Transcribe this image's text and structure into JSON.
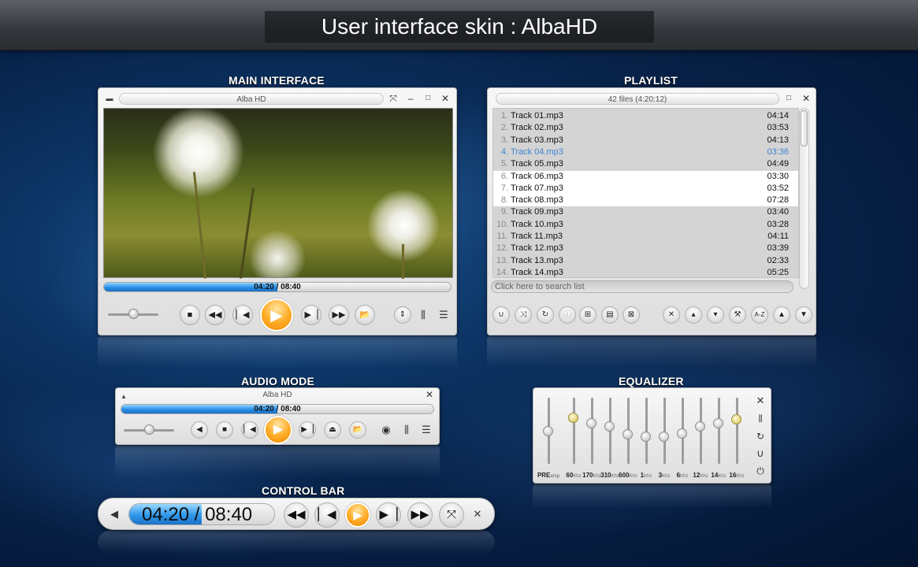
{
  "banner": {
    "title": "User interface skin : AlbaHD"
  },
  "colors": {
    "accent_blue": "#2a8fe6",
    "accent_orange": "#ffae2a",
    "highlight_blue": "#3e83d3"
  },
  "sections": {
    "main": "MAIN INTERFACE",
    "playlist": "PLAYLIST",
    "audio": "AUDIO MODE",
    "equalizer": "EQUALIZER",
    "control": "CONTROL BAR"
  },
  "main": {
    "title": "Alba HD",
    "time": "04:20 / 08:40",
    "progress": 0.5,
    "volume": 0.5
  },
  "playlist": {
    "title": "42 files (4:20:12)",
    "search_placeholder": "Click here to search list",
    "tracks": [
      {
        "num": "1.",
        "name": "Track 01.mp3",
        "dur": "04:14",
        "state": ""
      },
      {
        "num": "2.",
        "name": "Track 02.mp3",
        "dur": "03:53",
        "state": ""
      },
      {
        "num": "3.",
        "name": "Track 03.mp3",
        "dur": "04:13",
        "state": ""
      },
      {
        "num": "4.",
        "name": "Track 04.mp3",
        "dur": "03:36",
        "state": "cur"
      },
      {
        "num": "5.",
        "name": "Track 05.mp3",
        "dur": "04:49",
        "state": ""
      },
      {
        "num": "6.",
        "name": "Track 06.mp3",
        "dur": "03:30",
        "state": "sel"
      },
      {
        "num": "7.",
        "name": "Track 07.mp3",
        "dur": "03:52",
        "state": "sel"
      },
      {
        "num": "8.",
        "name": "Track 08.mp3",
        "dur": "07:28",
        "state": "sel"
      },
      {
        "num": "9.",
        "name": "Track 09.mp3",
        "dur": "03:40",
        "state": ""
      },
      {
        "num": "10.",
        "name": "Track 10.mp3",
        "dur": "03:28",
        "state": ""
      },
      {
        "num": "11.",
        "name": "Track 11.mp3",
        "dur": "04:11",
        "state": ""
      },
      {
        "num": "12.",
        "name": "Track 12.mp3",
        "dur": "03:39",
        "state": ""
      },
      {
        "num": "13.",
        "name": "Track 13.mp3",
        "dur": "02:33",
        "state": ""
      },
      {
        "num": "14.",
        "name": "Track 14.mp3",
        "dur": "05:25",
        "state": ""
      }
    ]
  },
  "audio": {
    "title": "Alba HD",
    "time": "04:20 / 08:40",
    "progress": 0.5,
    "volume": 0.5
  },
  "equalizer": {
    "bands": [
      {
        "label": "PRE",
        "sub": "amp",
        "level": 0.5,
        "gold": false
      },
      {
        "label": "60",
        "sub": "Khz",
        "level": 0.7,
        "gold": true
      },
      {
        "label": "170",
        "sub": "Khz",
        "level": 0.62,
        "gold": false
      },
      {
        "label": "310",
        "sub": "Khz",
        "level": 0.57,
        "gold": false
      },
      {
        "label": "600",
        "sub": "Khz",
        "level": 0.45,
        "gold": false
      },
      {
        "label": "1",
        "sub": "Khz",
        "level": 0.42,
        "gold": false
      },
      {
        "label": "3",
        "sub": "Khz",
        "level": 0.42,
        "gold": false
      },
      {
        "label": "6",
        "sub": "Khz",
        "level": 0.47,
        "gold": false
      },
      {
        "label": "12",
        "sub": "Khz",
        "level": 0.57,
        "gold": false
      },
      {
        "label": "14",
        "sub": "Khz",
        "level": 0.62,
        "gold": false
      },
      {
        "label": "16",
        "sub": "Khz",
        "level": 0.68,
        "gold": true
      }
    ]
  },
  "control": {
    "time_current": "04:20",
    "time_sep": " / ",
    "time_total": "08:40",
    "progress": 0.5
  }
}
